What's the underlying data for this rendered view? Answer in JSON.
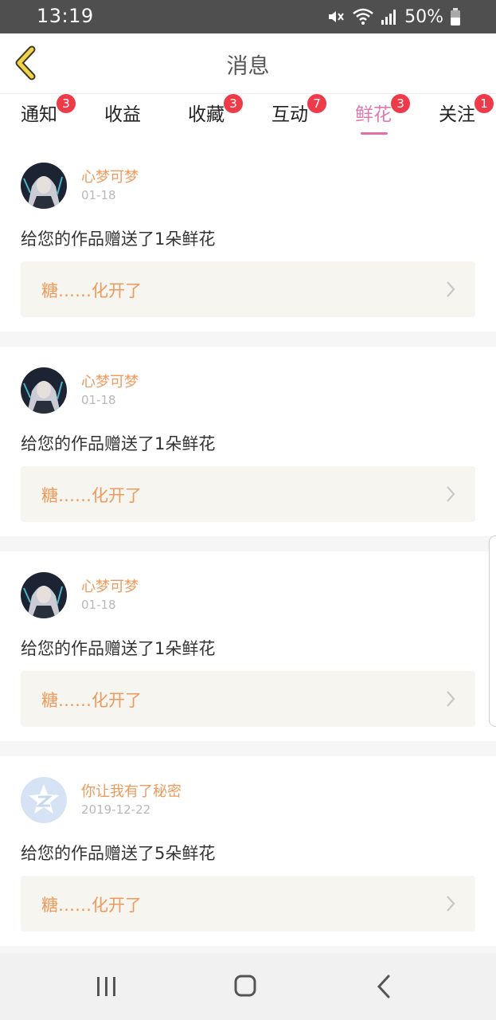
{
  "status_bar": {
    "time": "13:19",
    "battery_percent": "50%",
    "icons": [
      "mute-icon",
      "wifi-icon",
      "signal-icon",
      "battery-icon"
    ]
  },
  "header": {
    "title": "消息",
    "back_icon": "chevron-left-icon"
  },
  "tabs": [
    {
      "label": "通知",
      "badge": "3"
    },
    {
      "label": "收益",
      "badge": ""
    },
    {
      "label": "收藏",
      "badge": "3"
    },
    {
      "label": "互动",
      "badge": "7"
    },
    {
      "label": "鲜花",
      "badge": "3",
      "active": true
    },
    {
      "label": "关注",
      "badge": "1"
    }
  ],
  "messages": [
    {
      "user": "心梦可梦",
      "date": "01-18",
      "text": "给您的作品赠送了1朵鲜花",
      "work_title": "糖……化开了",
      "avatar": "anime-avatar"
    },
    {
      "user": "心梦可梦",
      "date": "01-18",
      "text": "给您的作品赠送了1朵鲜花",
      "work_title": "糖……化开了",
      "avatar": "anime-avatar"
    },
    {
      "user": "心梦可梦",
      "date": "01-18",
      "text": "给您的作品赠送了1朵鲜花",
      "work_title": "糖……化开了",
      "avatar": "anime-avatar"
    },
    {
      "user": "你让我有了秘密",
      "date": "2019-12-22",
      "text": "给您的作品赠送了5朵鲜花",
      "work_title": "糖……化开了",
      "avatar": "qzone-default-avatar"
    }
  ],
  "nav_bar": {
    "icons": [
      "recent-apps-icon",
      "home-icon",
      "back-icon"
    ]
  },
  "colors": {
    "accent_pink": "#e56fa7",
    "name_orange": "#ef9a5c",
    "badge_red": "#ee3b4a",
    "back_arrow_yellow": "#f3d34a"
  }
}
